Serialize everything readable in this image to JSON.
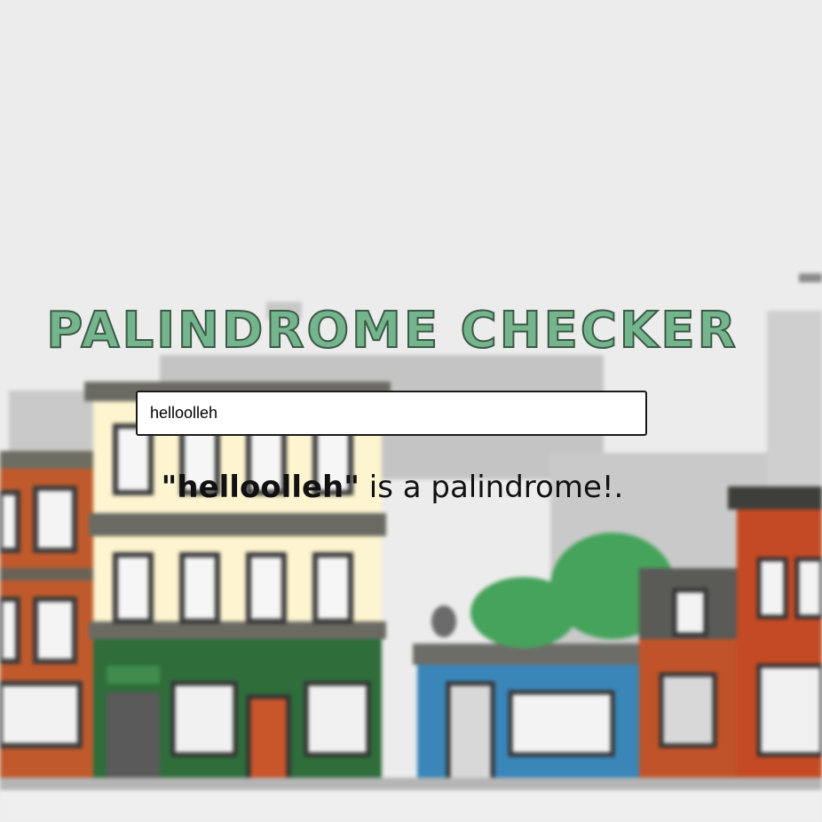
{
  "app": {
    "title": "PALINDROME CHECKER"
  },
  "input": {
    "value": "helloolleh"
  },
  "result": {
    "word": "\"helloolleh\"",
    "message": " is a palindrome!."
  },
  "background": {
    "description_icon": "town-street-illustration-icon"
  },
  "colors": {
    "title_fill": "#74b58d",
    "title_outline": "#3c5a46",
    "page_background": "#ececec"
  }
}
